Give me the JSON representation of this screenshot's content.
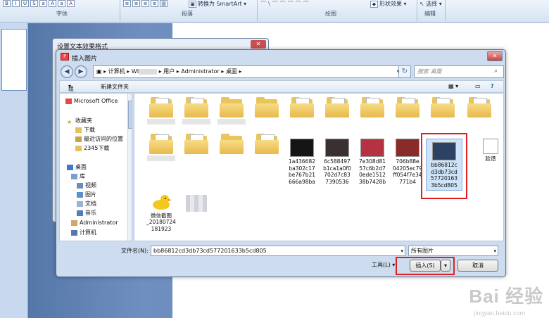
{
  "ribbon": {
    "groups": [
      "字体",
      "段落",
      "绘图",
      "编辑"
    ],
    "buttons": {
      "convert_smartart": "转换为 SmartArt",
      "shape_effect": "形状效果",
      "select": "选择"
    }
  },
  "back_dialog": {
    "title": "设置文本效果格式"
  },
  "dialog": {
    "title": "插入图片",
    "address": [
      "计算机",
      "WI",
      "用户",
      "Administrator",
      "桌面"
    ],
    "search_placeholder": "搜索 桌面",
    "toolbar": {
      "organize": "组织",
      "new_folder": "新建文件夹"
    }
  },
  "nav": [
    {
      "label": "Microsoft Office",
      "icon": "office-icon"
    },
    {
      "label": "收藏夹",
      "icon": "star-icon"
    },
    {
      "label": "下载",
      "icon": "download-folder-icon"
    },
    {
      "label": "最近访问的位置",
      "icon": "recent-icon"
    },
    {
      "label": "2345下载",
      "icon": "folder-icon"
    },
    {
      "label": "桌面",
      "icon": "desktop-icon"
    },
    {
      "label": "库",
      "icon": "library-icon"
    },
    {
      "label": "视频",
      "icon": "video-icon"
    },
    {
      "label": "图片",
      "icon": "picture-icon"
    },
    {
      "label": "文档",
      "icon": "document-icon"
    },
    {
      "label": "音乐",
      "icon": "music-icon"
    },
    {
      "label": "Administrator",
      "icon": "user-icon"
    },
    {
      "label": "计算机",
      "icon": "computer-icon"
    }
  ],
  "files": {
    "row3": [
      {
        "name": "1a436682ba302c17be767b21666a98ba",
        "lines": [
          "1a436682",
          "ba302c17",
          "be767b21",
          "666a98ba"
        ],
        "thumb": "#151515"
      },
      {
        "name": "6c588497b1ca1a0f0702d7c837390536",
        "lines": [
          "6c588497",
          "b1ca1a0f0",
          "702d7c83",
          "7390536"
        ],
        "thumb": "#3a3030"
      },
      {
        "name": "7e308d8157c6b2d70ede151238b7428b",
        "lines": [
          "7e308d81",
          "57c6b2d7",
          "0ede1512",
          "38b7428b"
        ],
        "thumb": "#b53240"
      },
      {
        "name": "706b88e04205ec79ff054f7e34771b4",
        "lines": [
          "706b88e",
          "04205ec79",
          "ff054f7e34",
          "771b4"
        ],
        "thumb": "#8a2b2b"
      },
      {
        "name": "bb86812cd3db73cd577201633b5cd805",
        "lines": [
          "bb86812c",
          "d3db73cd",
          "57720163",
          "3b5cd805"
        ],
        "thumb": "#2d4262"
      },
      {
        "name": "脸谱",
        "lines": [
          "脸谱"
        ],
        "thumb": "#ffffff"
      }
    ],
    "screenshot": {
      "lines": [
        "微信截图",
        "_20180724",
        "181923"
      ]
    }
  },
  "bottom": {
    "filename_label": "文件名(N):",
    "filename_value": "bb86812cd3db73cd577201633b5cd805",
    "filetype_value": "所有图片",
    "tools_label": "工具(L)",
    "insert_label": "插入(S)",
    "cancel_label": "取消"
  },
  "watermark": {
    "main": "Bai 经验",
    "sub": "jingyan.baidu.com"
  }
}
